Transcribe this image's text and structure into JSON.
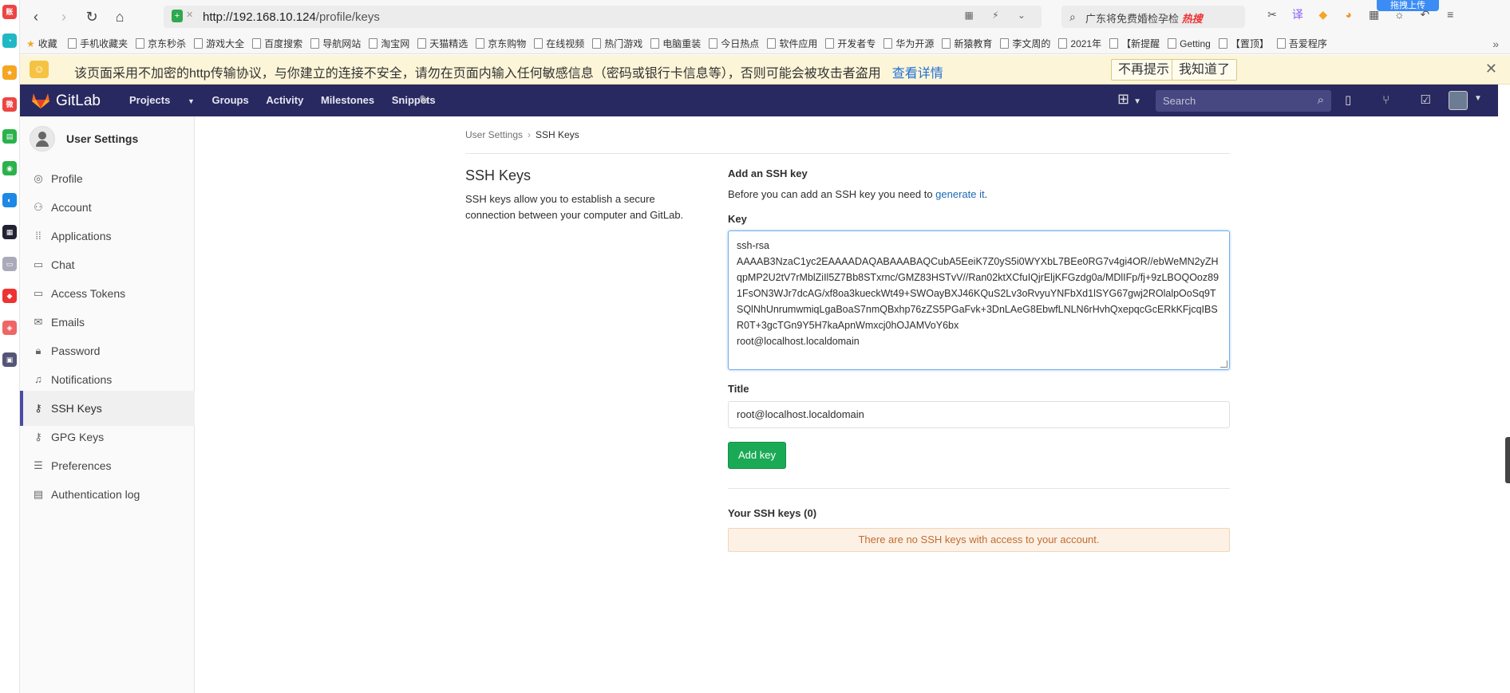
{
  "browser": {
    "url_host": "http://192.168.10.124",
    "url_path": "/profile/keys",
    "search_text": "广东将免费婚检孕检",
    "search_hot": "热搜",
    "upload_badge": "拖拽上传",
    "bookmarks_star_label": "收藏",
    "bookmarks": [
      "手机收藏夹",
      "京东秒杀",
      "游戏大全",
      "百度搜索",
      "导航网站",
      "淘宝网",
      "天猫精选",
      "京东购物",
      "在线视频",
      "热门游戏",
      "电脑重装",
      "今日热点",
      "软件应用",
      "开发者专",
      "华为开源",
      "新猿教育",
      "李文周的",
      "2021年",
      "【新提醒",
      "Getting",
      "【置顶】",
      "吾爱程序"
    ]
  },
  "banner": {
    "text": "该页面采用不加密的http传输协议，与你建立的连接不安全，请勿在页面内输入任何敏感信息（密码或银行卡信息等），否则可能会被攻击者盗用",
    "link": "查看详情",
    "btn_dismiss": "不再提示",
    "btn_ok": "我知道了"
  },
  "header": {
    "brand": "GitLab",
    "nav": [
      "Projects",
      "Groups",
      "Activity",
      "Milestones",
      "Snippets"
    ],
    "search_placeholder": "Search"
  },
  "sidebar": {
    "title": "User Settings",
    "items": [
      {
        "label": "Profile",
        "icon": "profile-icon",
        "active": false
      },
      {
        "label": "Account",
        "icon": "account-icon",
        "active": false
      },
      {
        "label": "Applications",
        "icon": "applications-icon",
        "active": false
      },
      {
        "label": "Chat",
        "icon": "chat-icon",
        "active": false
      },
      {
        "label": "Access Tokens",
        "icon": "access-tokens-icon",
        "active": false
      },
      {
        "label": "Emails",
        "icon": "emails-icon",
        "active": false
      },
      {
        "label": "Password",
        "icon": "lock-icon",
        "active": false
      },
      {
        "label": "Notifications",
        "icon": "bell-icon",
        "active": false
      },
      {
        "label": "SSH Keys",
        "icon": "key-icon",
        "active": true
      },
      {
        "label": "GPG Keys",
        "icon": "key-icon",
        "active": false
      },
      {
        "label": "Preferences",
        "icon": "sliders-icon",
        "active": false
      },
      {
        "label": "Authentication log",
        "icon": "log-icon",
        "active": false
      }
    ]
  },
  "breadcrumb": {
    "parent": "User Settings",
    "current": "SSH Keys"
  },
  "section": {
    "title": "SSH Keys",
    "description": "SSH keys allow you to establish a secure connection between your computer and GitLab."
  },
  "form": {
    "add_title": "Add an SSH key",
    "add_desc": "Before you can add an SSH key you need to ",
    "add_desc_link": "generate it",
    "add_desc_end": ".",
    "key_label": "Key",
    "key_value": "ssh-rsa\nAAAAB3NzaC1yc2EAAAADAQABAAABAQCubA5EeiK7Z0yS5i0WYXbL7BEe0RG7v4gi4OR//ebWeMN2yZHqpMP2U2tV7rMblZiIl5Z7Bb8STxrnc/GMZ83HSTvV//Ran02ktXCfuIQjrEljKFGzdg0a/MDlIFp/fj+9zLBOQOoz891FsON3WJr7dcAG/xf8oa3kueckWt49+SWOayBXJ46KQuS2Lv3oRvyuYNFbXd1lSYG67gwj2ROlalpOoSq9TSQlNhUnrumwmiqLgaBoaS7nmQBxhp76zZS5PGaFvk+3DnLAeG8EbwfLNLN6rHvhQxepqcGcERkKFjcqIBSR0T+3gcTGn9Y5H7kaApnWmxcj0hOJAMVoY6bx\nroot@localhost.localdomain",
    "title_label": "Title",
    "title_value": "root@localhost.localdomain",
    "add_button": "Add key",
    "your_keys": "Your SSH keys (0)",
    "no_keys": "There are no SSH keys with access to your account."
  },
  "colors": {
    "header_bg": "#292961",
    "accent_green": "#1aaa55",
    "link_blue": "#1b69b6",
    "warning_bg": "#fdf1e6",
    "warning_text": "#c26c2e"
  }
}
